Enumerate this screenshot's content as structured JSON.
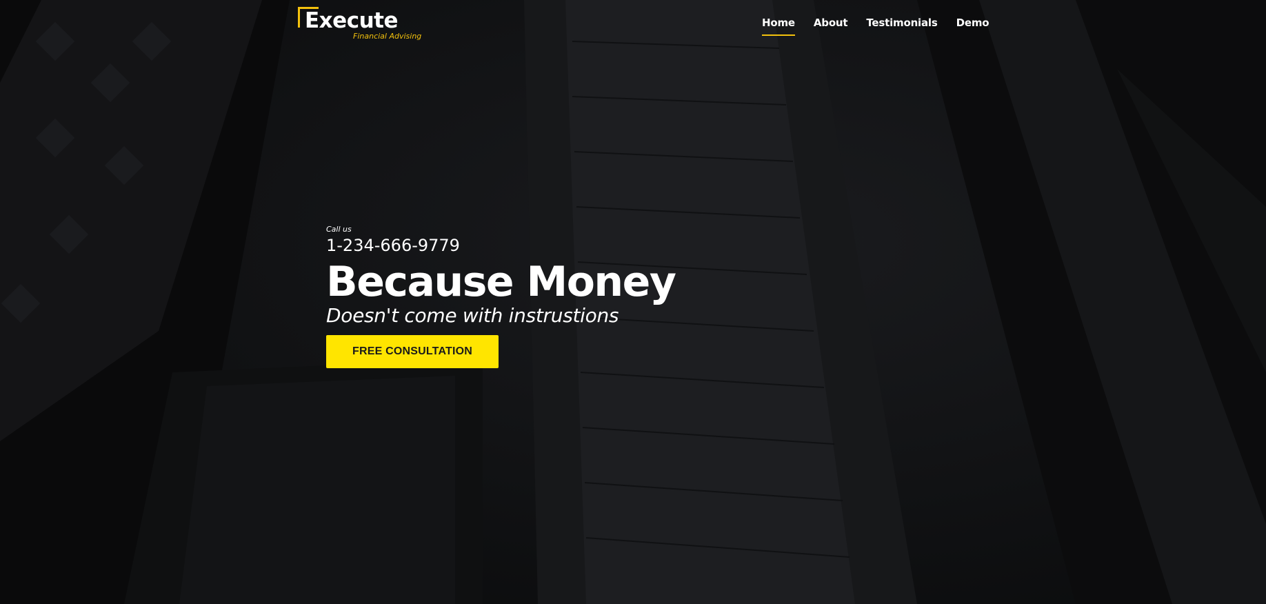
{
  "brand": {
    "name": "Execute",
    "tagline": "Financial Advising",
    "accent_color": "#f4c20d"
  },
  "nav": {
    "items": [
      {
        "label": "Home",
        "active": true
      },
      {
        "label": "About",
        "active": false
      },
      {
        "label": "Testimonials",
        "active": false
      },
      {
        "label": "Demo",
        "active": false
      }
    ]
  },
  "hero": {
    "call_label": "Call us",
    "phone": "1-234-666-9779",
    "headline": "Because Money",
    "subheadline": "Doesn't come with instrustions",
    "cta_label": "FREE CONSULTATION",
    "cta_color": "#ffe500"
  }
}
